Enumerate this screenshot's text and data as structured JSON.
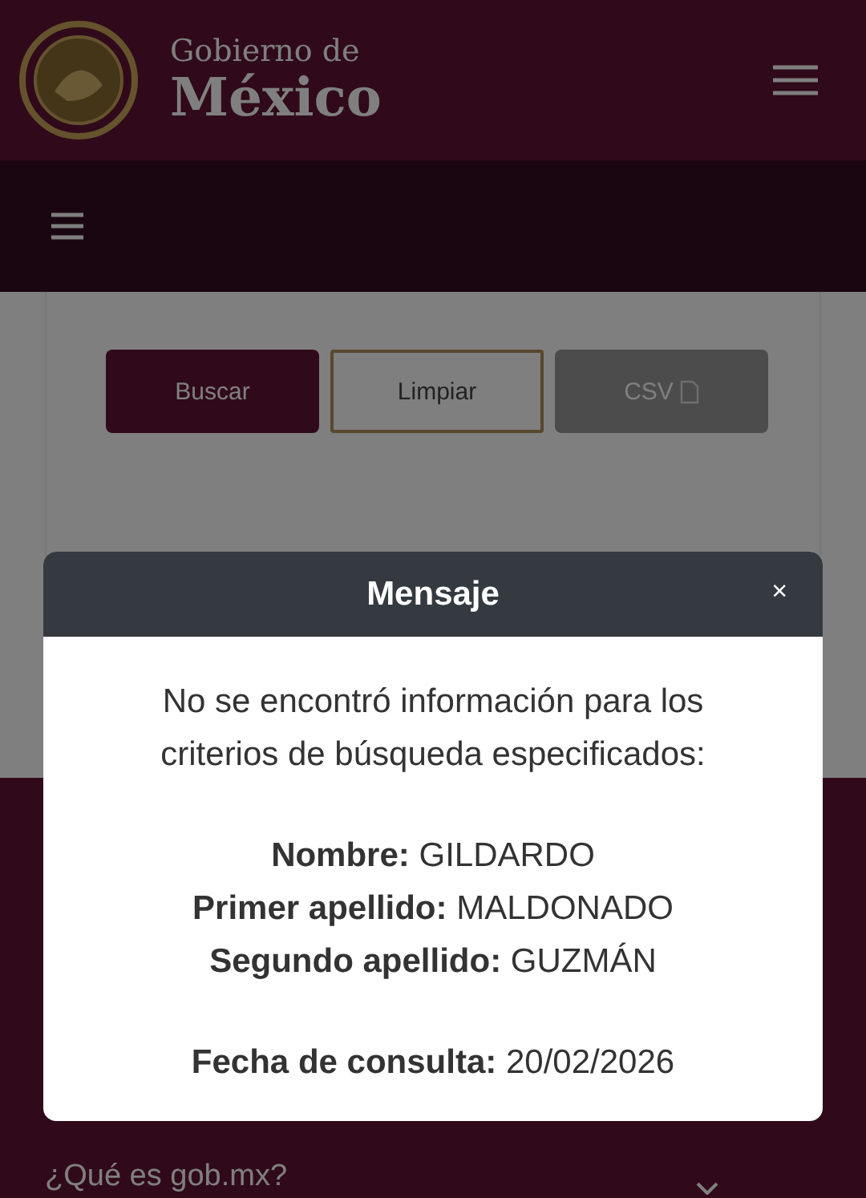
{
  "header": {
    "logo_top": "Gobierno de",
    "logo_bottom": "México"
  },
  "buttons": [
    {
      "label": "Buscar",
      "kind": "primary"
    },
    {
      "label": "Limpiar",
      "kind": "outline"
    },
    {
      "label": "CSV",
      "kind": "disabled"
    }
  ],
  "footer": {
    "heading": "¿Qué es gob.mx?"
  },
  "modal": {
    "title": "Mensaje",
    "close": "×",
    "message": "No se encontró información para los criterios de búsqueda especificados:",
    "fields": [
      "**Nombre:** GILDARDO",
      "**Primer apellido:** MALDONADO",
      "**Segundo apellido:** GUZMÁN"
    ],
    "date": "**Fecha de consulta:** 20/02/2026"
  }
}
